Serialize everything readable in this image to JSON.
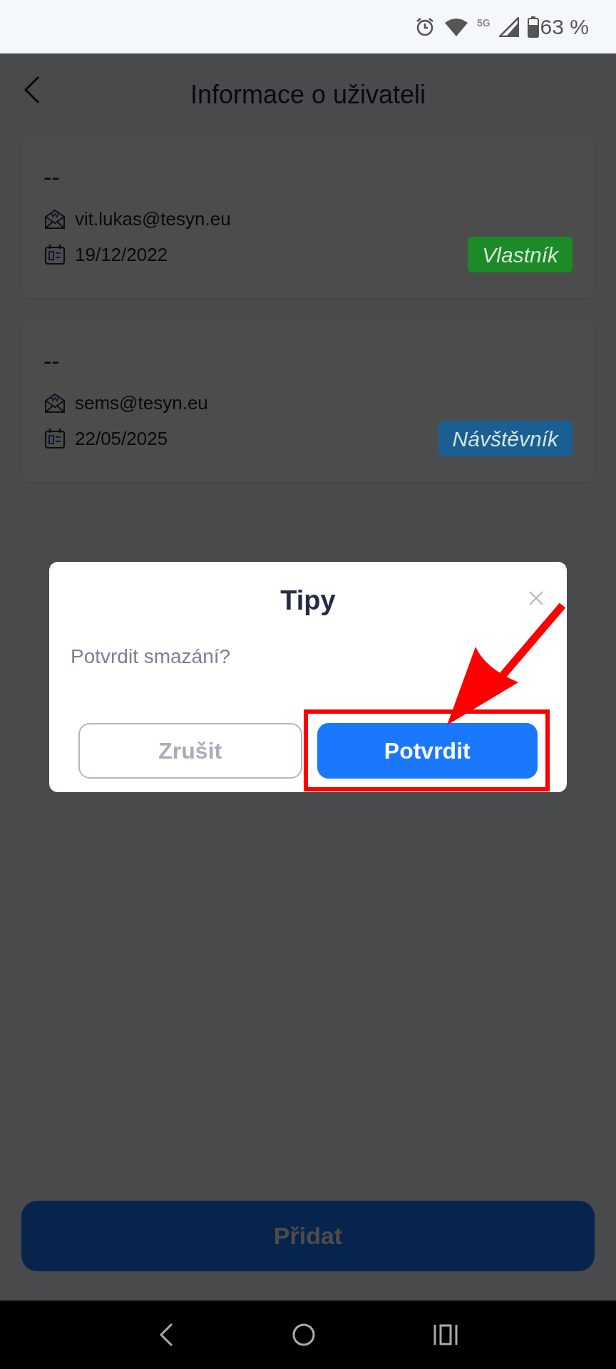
{
  "status_bar": {
    "network": "5G",
    "battery": "63 %"
  },
  "header": {
    "title": "Informace o uživateli"
  },
  "users": [
    {
      "name": "--",
      "email": "vit.lukas@tesyn.eu",
      "date": "19/12/2022",
      "role": "Vlastník",
      "color": "#1c8a26"
    },
    {
      "name": "--",
      "email": "sems@tesyn.eu",
      "date": "22/05/2025",
      "role": "Návštěvník",
      "color": "#1a5f94"
    }
  ],
  "add_button": "Přidat",
  "dialog": {
    "title": "Tipy",
    "message": "Potvrdit smazání?",
    "buttons": [
      {
        "label": "Zrušit",
        "kind": "secondary"
      },
      {
        "label": "Potvrdit",
        "kind": "primary"
      }
    ]
  }
}
